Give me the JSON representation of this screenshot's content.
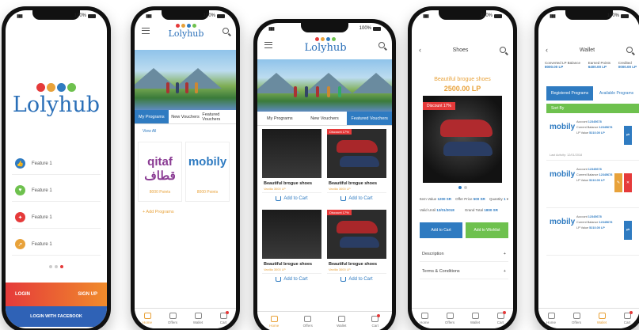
{
  "colors": {
    "brand_blue": "#2f7bc1",
    "accent_orange": "#e8a23a",
    "alert_red": "#e53a3a",
    "success_green": "#6ec14e",
    "facebook_blue": "#2f62b6"
  },
  "status": {
    "battery": "100%"
  },
  "logo": {
    "text": "Lolyhub",
    "dot_colors": [
      "#e53a3a",
      "#e8a23a",
      "#2f7bc1",
      "#6ec14e"
    ]
  },
  "phone1": {
    "features": [
      {
        "label": "Feature 1",
        "color": "#2f7bc1",
        "icon": "thumbs-up-icon",
        "glyph": "👍"
      },
      {
        "label": "Feature 1",
        "color": "#6ec14e",
        "icon": "heart-icon",
        "glyph": "♥"
      },
      {
        "label": "Feature 1",
        "color": "#e53a3a",
        "icon": "tag-icon",
        "glyph": "✦"
      },
      {
        "label": "Feature 1",
        "color": "#e8a23a",
        "icon": "rocket-icon",
        "glyph": "➚"
      }
    ],
    "login_label": "LOGIN",
    "signup_label": "SIGN UP",
    "facebook_label": "LOGIN WITH FACEBOOK"
  },
  "phone2": {
    "tabs": [
      "My Programs",
      "New Vouchers",
      "Featured Vouchers"
    ],
    "view_all": "View All",
    "partners": [
      {
        "brand": "qitaf قطاف",
        "label": "8000 Points"
      },
      {
        "brand": "mobily",
        "label": "8000 Points"
      }
    ],
    "add_programs": "+ Add Programs",
    "tabbar": [
      "Home",
      "Offers",
      "Wallet",
      "Cart"
    ]
  },
  "phone3": {
    "tabs": [
      "My Programs",
      "New Vouchers",
      "Featured Vouchers"
    ],
    "products": [
      {
        "title": "Beautiful brogue shoes",
        "sub": "Vanilla 3000 LP",
        "discount": "",
        "add": "Add to Cart"
      },
      {
        "title": "Beautiful brogue shoes",
        "sub": "Vanilla 3000 LP",
        "discount": "Discount 17%",
        "add": "Add to Cart"
      },
      {
        "title": "Beautiful brogue shoes",
        "sub": "Vanilla 3000 LP",
        "discount": "",
        "add": "Add to Cart"
      },
      {
        "title": "Beautiful brogue shoes",
        "sub": "Vanilla 3000 LP",
        "discount": "Discount 17%",
        "add": "Add to Cart"
      }
    ],
    "tabbar": [
      "Home",
      "Offers",
      "Wallet",
      "Cart"
    ]
  },
  "phone4": {
    "header": "Shoes",
    "title": "Beautiful brogue shoes",
    "price": "2500.00 LP",
    "discount": "Discount 17%",
    "rows": [
      {
        "l": "Item Value",
        "lv": "1200 SR",
        "m": "Offer Price",
        "mv": "500 SR",
        "r": "Quantity",
        "rv": "1"
      },
      {
        "l": "Valid Until",
        "lv": "12/01/2018",
        "m": "Grand Total",
        "mv": "1800 SR",
        "r": "",
        "rv": ""
      }
    ],
    "add_label": "Add to Cart",
    "wishlist_label": "Add to Wishlist",
    "description": "Description",
    "terms": "Terms & Conditions",
    "tabbar": [
      "Home",
      "Offers",
      "Wallet",
      "Cart"
    ]
  },
  "phone5": {
    "header": "Wallet",
    "balances": [
      {
        "label": "Converted LP Balance",
        "value": "8000.00 LP"
      },
      {
        "label": "Earned Points",
        "value": "6400.00 LP"
      },
      {
        "label": "Credited",
        "value": "0000.00 LP"
      }
    ],
    "tabs": [
      "Registered Programs",
      "Available Programs"
    ],
    "sort": "Sort By",
    "cards": [
      {
        "brand": "mobily",
        "acc_label": "Account",
        "acc": "12345678",
        "bal_label": "Current Balance",
        "bal": "12345678",
        "lp_label": "LP Value",
        "lp": "5210.00 LP",
        "foot": "Last Activity: 12/01/2018"
      },
      {
        "brand": "mobily",
        "acc_label": "Account",
        "acc": "12345678",
        "bal_label": "Current Balance",
        "bal": "12345678",
        "lp_label": "LP Value",
        "lp": "5210.00 LP",
        "foot": ""
      },
      {
        "brand": "mobily",
        "acc_label": "Account",
        "acc": "12345678",
        "bal_label": "Current Balance",
        "bal": "12345678",
        "lp_label": "LP Value",
        "lp": "5210.00 LP",
        "foot": ""
      }
    ],
    "tabbar": [
      "Home",
      "Offers",
      "Wallet",
      "Cart"
    ]
  }
}
